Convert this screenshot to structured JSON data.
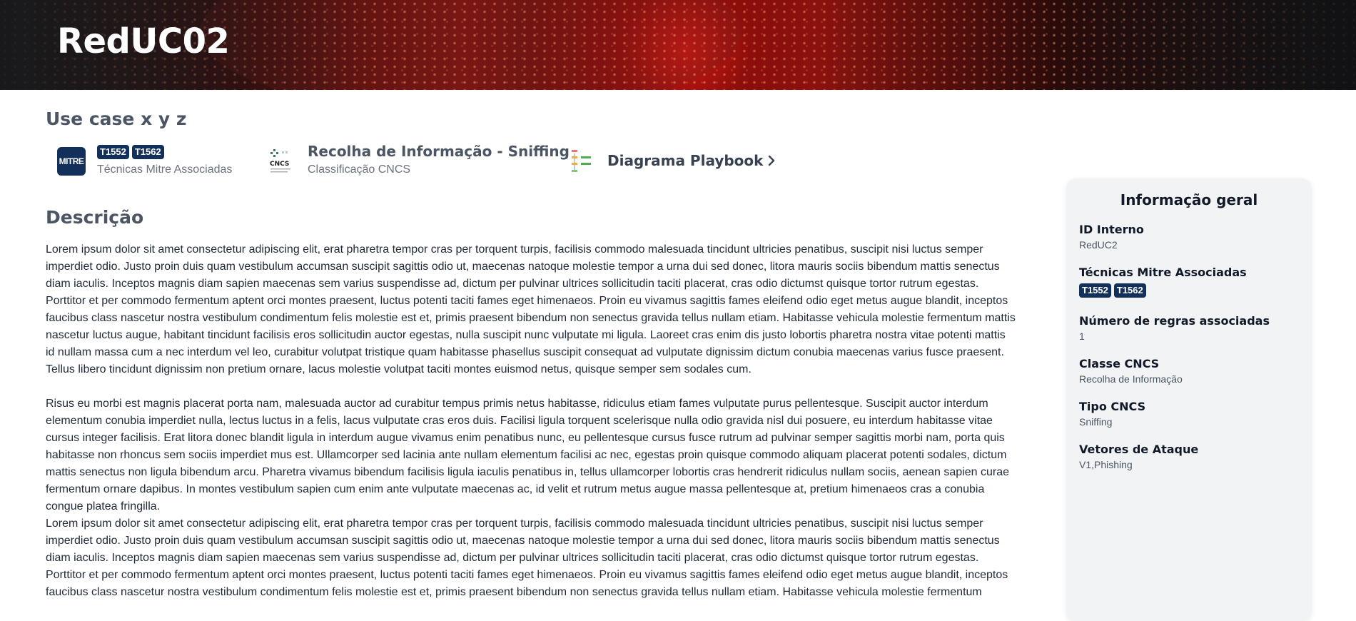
{
  "header": {
    "title": "RedUC02"
  },
  "page": {
    "subtitle": "Use case x y z"
  },
  "meta": {
    "mitre_logo_text": "MITRE",
    "techniques": [
      "T1552",
      "T1562"
    ],
    "techniques_label": "Técnicas Mitre Associadas",
    "cncs_logo_text": "CNCS",
    "cncs_title": "Recolha de Informação - Sniffing",
    "cncs_sub": "Classificação CNCS",
    "playbook_label": "Diagrama Playbook"
  },
  "description": {
    "heading": "Descrição",
    "paragraphs": [
      "Lorem ipsum dolor sit amet consectetur adipiscing elit, erat pharetra tempor cras per torquent turpis, facilisis commodo malesuada tincidunt ultricies penatibus, suscipit nisi luctus semper imperdiet odio. Justo proin duis quam vestibulum accumsan suscipit sagittis odio ut, maecenas natoque molestie tempor a urna dui sed donec, litora mauris sociis bibendum mattis senectus diam iaculis. Inceptos magnis diam sapien maecenas sem varius suspendisse ad, dictum per pulvinar ultrices sollicitudin taciti placerat, cras odio dictumst quisque tortor rutrum egestas. Porttitor et per commodo fermentum aptent orci montes praesent, luctus potenti taciti fames eget himenaeos. Proin eu vivamus sagittis fames eleifend odio eget metus augue blandit, inceptos faucibus class nascetur nostra vestibulum condimentum felis molestie est et, primis praesent bibendum non senectus gravida tellus nullam etiam. Habitasse vehicula molestie fermentum mattis nascetur luctus augue, habitant tincidunt facilisis eros sollicitudin auctor egestas, nulla suscipit nunc vulputate mi ligula. Laoreet cras enim dis justo lobortis pharetra nostra vitae potenti mattis id nullam massa cum a nec interdum vel leo, curabitur volutpat tristique quam habitasse phasellus suscipit consequat ad vulputate dignissim dictum conubia maecenas varius fusce praesent. Tellus libero tincidunt dignissim non pretium ornare, lacus molestie volutpat taciti montes euismod netus, quisque semper sem sodales cum.",
      "Risus eu morbi est magnis placerat porta nam, malesuada auctor ad curabitur tempus primis netus habitasse, ridiculus etiam fames vulputate purus pellentesque. Suscipit auctor interdum elementum conubia imperdiet nulla, lectus luctus in a felis, lacus vulputate cras eros duis. Facilisi ligula torquent scelerisque nulla odio gravida nisl dui posuere, eu interdum habitasse vitae cursus integer facilisis. Erat litora donec blandit ligula in interdum augue vivamus enim penatibus nunc, eu pellentesque cursus fusce rutrum ad pulvinar semper sagittis morbi nam, porta quis habitasse non rhoncus sem sociis imperdiet mus est. Ullamcorper sed lacinia ante nullam elementum facilisi ac nec, egestas proin quisque commodo aliquam placerat potenti sodales, dictum mattis senectus non ligula bibendum arcu. Pharetra vivamus bibendum facilisis ligula iaculis penatibus in, tellus ullamcorper lobortis cras hendrerit ridiculus nullam sociis, aenean sapien curae fermentum ornare dapibus. In montes vestibulum sapien cum enim ante vulputate maecenas ac, id velit et rutrum metus augue massa pellentesque at, pretium himenaeos cras a conubia congue platea fringilla.",
      "Lorem ipsum dolor sit amet consectetur adipiscing elit, erat pharetra tempor cras per torquent turpis, facilisis commodo malesuada tincidunt ultricies penatibus, suscipit nisi luctus semper imperdiet odio. Justo proin duis quam vestibulum accumsan suscipit sagittis odio ut, maecenas natoque molestie tempor a urna dui sed donec, litora mauris sociis bibendum mattis senectus diam iaculis. Inceptos magnis diam sapien maecenas sem varius suspendisse ad, dictum per pulvinar ultrices sollicitudin taciti placerat, cras odio dictumst quisque tortor rutrum egestas. Porttitor et per commodo fermentum aptent orci montes praesent, luctus potenti taciti fames eget himenaeos. Proin eu vivamus sagittis fames eleifend odio eget metus augue blandit, inceptos faucibus class nascetur nostra vestibulum condimentum felis molestie est et, primis praesent bibendum non senectus gravida tellus nullam etiam. Habitasse vehicula molestie fermentum"
    ]
  },
  "info": {
    "title": "Informação geral",
    "id_label": "ID Interno",
    "id_value": "RedUC2",
    "techniques_label": "Técnicas Mitre Associadas",
    "rules_label": "Número de regras associadas",
    "rules_value": "1",
    "class_label": "Classe CNCS",
    "class_value": "Recolha de Informação",
    "type_label": "Tipo CNCS",
    "type_value": "Sniffing",
    "vectors_label": "Vetores de Ataque",
    "vectors_value": "V1,Phishing"
  }
}
